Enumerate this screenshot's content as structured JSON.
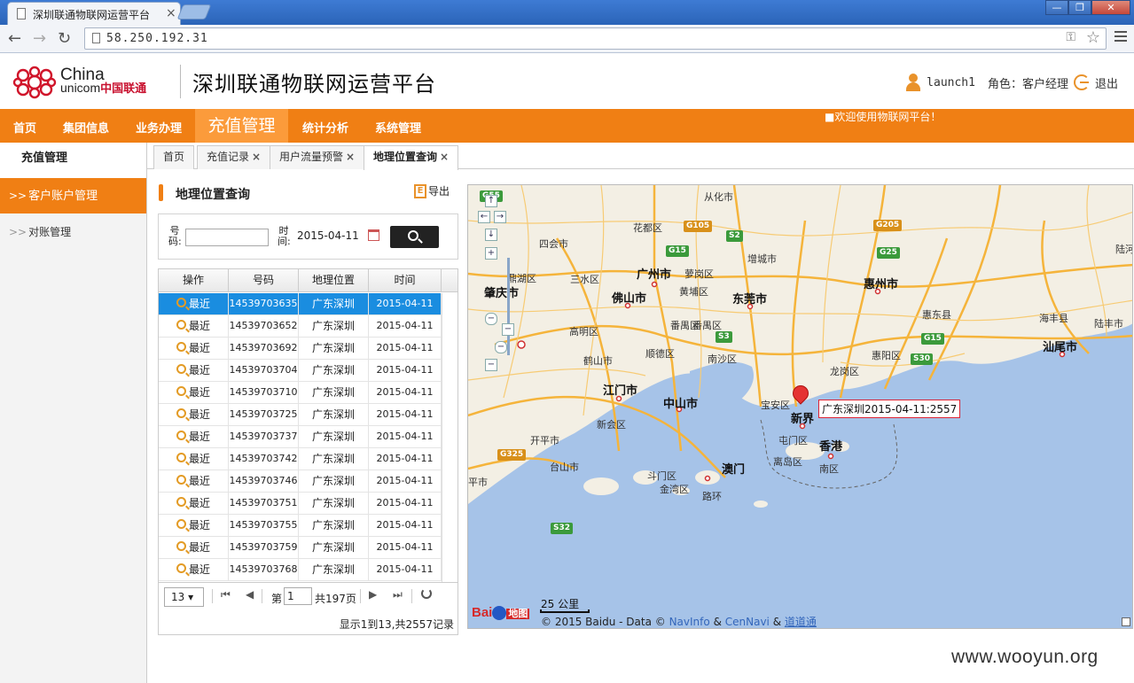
{
  "browser": {
    "tab_title": "深圳联通物联网运营平台",
    "url": "58.250.192.31"
  },
  "header": {
    "logo_line1": "China",
    "logo_line2": "unicom",
    "logo_cn": "中国联通",
    "platform_title": "深圳联通物联网运营平台",
    "username": "launch1",
    "role": "角色：客户经理",
    "logout": "退出"
  },
  "nav": {
    "items": [
      "首页",
      "集团信息",
      "业务办理",
      "充值管理",
      "统计分析",
      "系统管理"
    ],
    "active_index": 3,
    "marquee": "■欢迎使用物联网平台！"
  },
  "sidebar": {
    "title": "充值管理",
    "items": [
      "客户账户管理",
      "对账管理"
    ],
    "active_index": 0,
    "arrow": ">>"
  },
  "content_tabs": [
    {
      "label": "首页",
      "closable": false
    },
    {
      "label": "充值记录",
      "closable": true
    },
    {
      "label": "用户流量预警",
      "closable": true
    },
    {
      "label": "地理位置查询",
      "closable": true,
      "active": true
    }
  ],
  "panel": {
    "title": "地理位置查询",
    "export_label": "导出",
    "export_icon_letter": "E",
    "number_label": "号码:",
    "number_value": "",
    "time_label": "时间:",
    "time_value": "2015-04-11"
  },
  "grid": {
    "columns": [
      "操作",
      "号码",
      "地理位置",
      "时间"
    ],
    "action_label": "最近",
    "rows": [
      {
        "number": "14539703635",
        "location": "广东深圳",
        "date": "2015-04-11",
        "selected": true
      },
      {
        "number": "14539703652",
        "location": "广东深圳",
        "date": "2015-04-11"
      },
      {
        "number": "14539703692",
        "location": "广东深圳",
        "date": "2015-04-11"
      },
      {
        "number": "14539703704",
        "location": "广东深圳",
        "date": "2015-04-11"
      },
      {
        "number": "14539703710",
        "location": "广东深圳",
        "date": "2015-04-11"
      },
      {
        "number": "14539703725",
        "location": "广东深圳",
        "date": "2015-04-11"
      },
      {
        "number": "14539703737",
        "location": "广东深圳",
        "date": "2015-04-11"
      },
      {
        "number": "14539703742",
        "location": "广东深圳",
        "date": "2015-04-11"
      },
      {
        "number": "14539703746",
        "location": "广东深圳",
        "date": "2015-04-11"
      },
      {
        "number": "14539703751",
        "location": "广东深圳",
        "date": "2015-04-11"
      },
      {
        "number": "14539703755",
        "location": "广东深圳",
        "date": "2015-04-11"
      },
      {
        "number": "14539703759",
        "location": "广东深圳",
        "date": "2015-04-11"
      },
      {
        "number": "14539703768",
        "location": "广东深圳",
        "date": "2015-04-11"
      }
    ]
  },
  "pager": {
    "page_size": "13",
    "page_prefix": "第",
    "page_number": "1",
    "page_suffix": "共197页",
    "summary": "显示1到13,共2557记录"
  },
  "map": {
    "marker_label": "广东深圳2015-04-11:2557",
    "scale": "25 公里",
    "attribution": "© 2015 Baidu - Data ©",
    "attr_navinfo": "NavInfo",
    "attr_amp1": "&",
    "attr_cennavi": "CenNavi",
    "attr_amp2": "&",
    "attr_ddt": "道道通",
    "baidu_logo_text": "Bai",
    "baidu_logo_cn": "地图",
    "labels": [
      {
        "text": "从化市",
        "cls": ""
      },
      {
        "text": "花都区",
        "cls": ""
      },
      {
        "text": "增城市",
        "cls": ""
      },
      {
        "text": "四会市",
        "cls": ""
      },
      {
        "text": "广州市",
        "cls": "big"
      },
      {
        "text": "番禺区",
        "cls": ""
      },
      {
        "text": "三水区",
        "cls": ""
      },
      {
        "text": "黄埔区",
        "cls": ""
      },
      {
        "text": "佛山市",
        "cls": "big"
      },
      {
        "text": "东莞市",
        "cls": "big"
      },
      {
        "text": "惠州市",
        "cls": "big"
      },
      {
        "text": "惠东县",
        "cls": ""
      },
      {
        "text": "海丰县",
        "cls": ""
      },
      {
        "text": "陆丰市",
        "cls": ""
      },
      {
        "text": "陆河县",
        "cls": ""
      },
      {
        "text": "汕尾市",
        "cls": "big"
      },
      {
        "text": "肇庆市",
        "cls": "big"
      },
      {
        "text": "鼎湖区",
        "cls": ""
      },
      {
        "text": "高明区",
        "cls": ""
      },
      {
        "text": "番禺区",
        "cls": ""
      },
      {
        "text": "顺德区",
        "cls": ""
      },
      {
        "text": "南沙区",
        "cls": ""
      },
      {
        "text": "鹤山市",
        "cls": ""
      },
      {
        "text": "惠阳区",
        "cls": ""
      },
      {
        "text": "龙岗区",
        "cls": ""
      },
      {
        "text": "宝安区",
        "cls": ""
      },
      {
        "text": "新界",
        "cls": "big"
      },
      {
        "text": "江门市",
        "cls": "big"
      },
      {
        "text": "中山市",
        "cls": "big"
      },
      {
        "text": "新会区",
        "cls": ""
      },
      {
        "text": "屯门区",
        "cls": ""
      },
      {
        "text": "香港",
        "cls": "big"
      },
      {
        "text": "开平市",
        "cls": ""
      },
      {
        "text": "离岛区",
        "cls": ""
      },
      {
        "text": "南区",
        "cls": ""
      },
      {
        "text": "台山市",
        "cls": ""
      },
      {
        "text": "斗门区",
        "cls": ""
      },
      {
        "text": "澳门",
        "cls": "big"
      },
      {
        "text": "金湾区",
        "cls": ""
      },
      {
        "text": "路环",
        "cls": ""
      },
      {
        "text": "平市",
        "cls": ""
      },
      {
        "text": "萝岗区",
        "cls": ""
      }
    ],
    "highways": [
      {
        "text": "G55",
        "cls": "g"
      },
      {
        "text": "G105",
        "cls": "y"
      },
      {
        "text": "S2",
        "cls": "g"
      },
      {
        "text": "G205",
        "cls": "y"
      },
      {
        "text": "G15",
        "cls": "g"
      },
      {
        "text": "G25",
        "cls": "g"
      },
      {
        "text": "S3",
        "cls": "g"
      },
      {
        "text": "G15",
        "cls": "g"
      },
      {
        "text": "S30",
        "cls": "g"
      },
      {
        "text": "G325",
        "cls": "y"
      },
      {
        "text": "S32",
        "cls": "g"
      }
    ]
  },
  "watermark": "www.wooyun.org"
}
